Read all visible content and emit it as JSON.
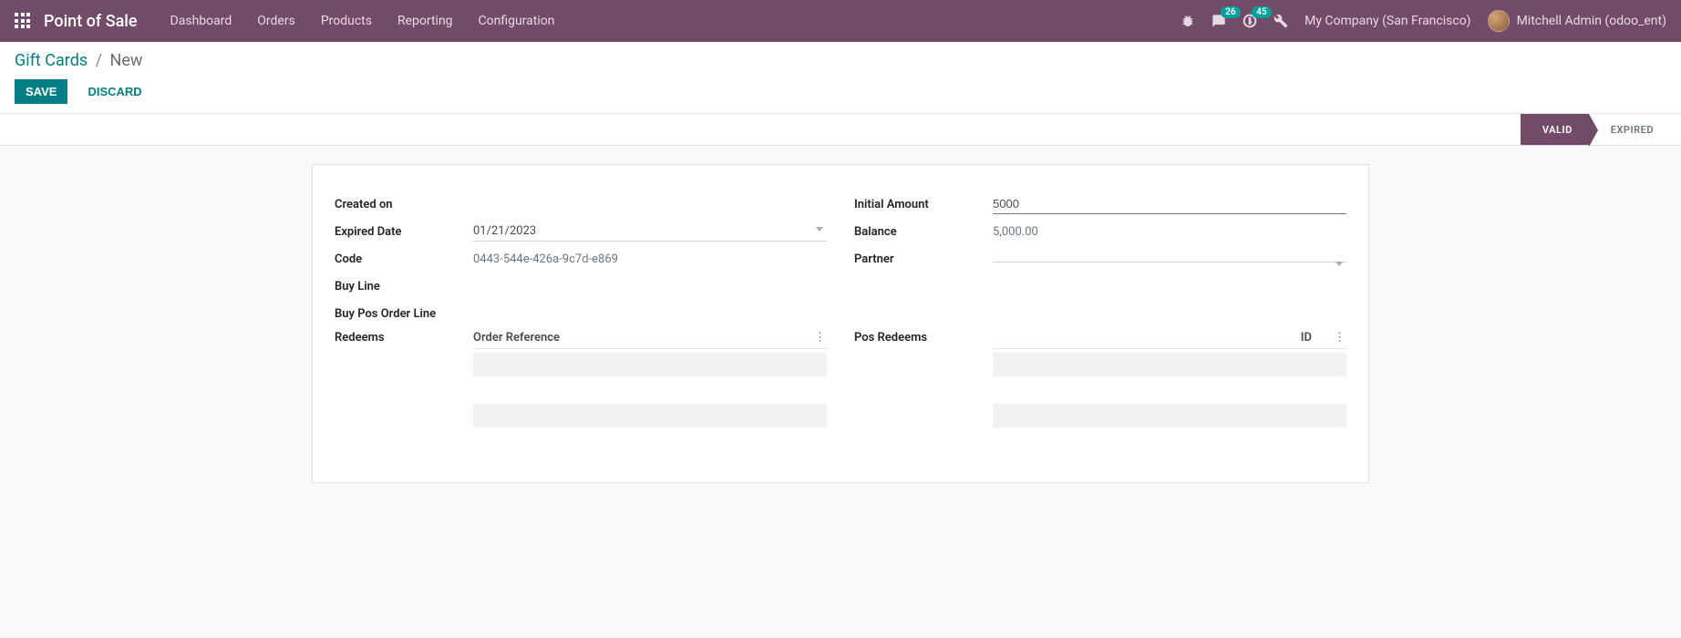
{
  "app_title": "Point of Sale",
  "nav_menu": [
    "Dashboard",
    "Orders",
    "Products",
    "Reporting",
    "Configuration"
  ],
  "systray": {
    "messages_badge": "26",
    "activities_badge": "45"
  },
  "company": "My Company (San Francisco)",
  "user": "Mitchell Admin (odoo_ent)",
  "breadcrumb": {
    "root": "Gift Cards",
    "current": "New"
  },
  "actions": {
    "save": "SAVE",
    "discard": "DISCARD"
  },
  "status": {
    "valid": "VALID",
    "expired": "EXPIRED"
  },
  "form": {
    "created_on_label": "Created on",
    "created_on_value": "",
    "expired_date_label": "Expired Date",
    "expired_date_value": "01/21/2023",
    "code_label": "Code",
    "code_value": "0443-544e-426a-9c7d-e869",
    "buy_line_label": "Buy Line",
    "buy_pos_order_line_label": "Buy Pos Order Line",
    "redeems_label": "Redeems",
    "redeems_col_order_ref": "Order Reference",
    "initial_amount_label": "Initial Amount",
    "initial_amount_value": "5000",
    "balance_label": "Balance",
    "balance_value": "5,000.00",
    "partner_label": "Partner",
    "partner_value": "",
    "pos_redeems_label": "Pos Redeems",
    "pos_redeems_col_id": "ID"
  }
}
